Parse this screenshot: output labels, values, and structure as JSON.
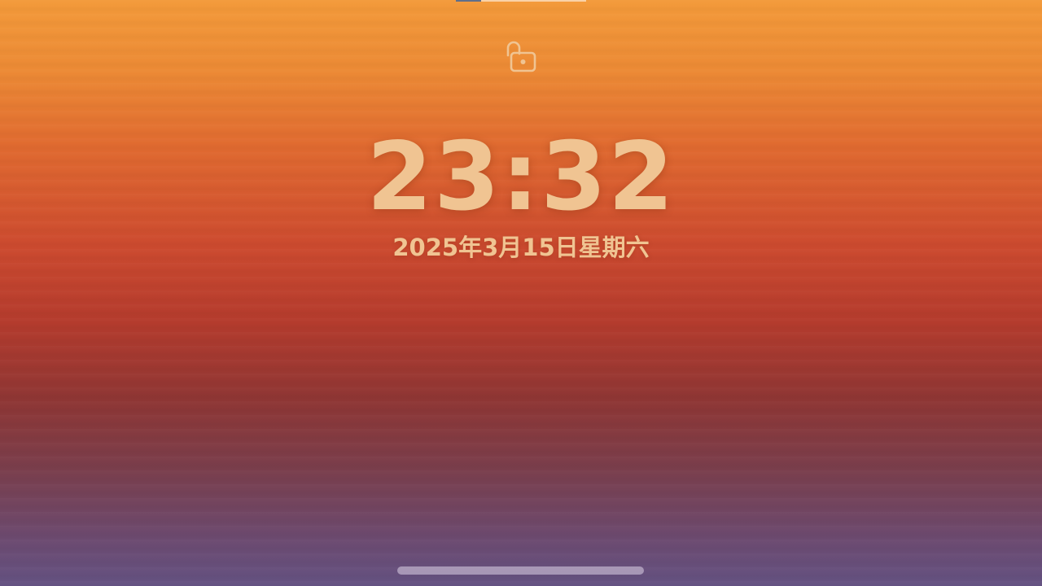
{
  "lock_screen": {
    "time": "23:32",
    "date": "2025年3月15日星期六",
    "lock_icon": "unlocked-padlock-icon",
    "accent_color": "#f0c492"
  },
  "wallpaper": {
    "colors": [
      "#f39a3a",
      "#e06a30",
      "#b43b2d",
      "#7a3e4c",
      "#645282"
    ]
  }
}
